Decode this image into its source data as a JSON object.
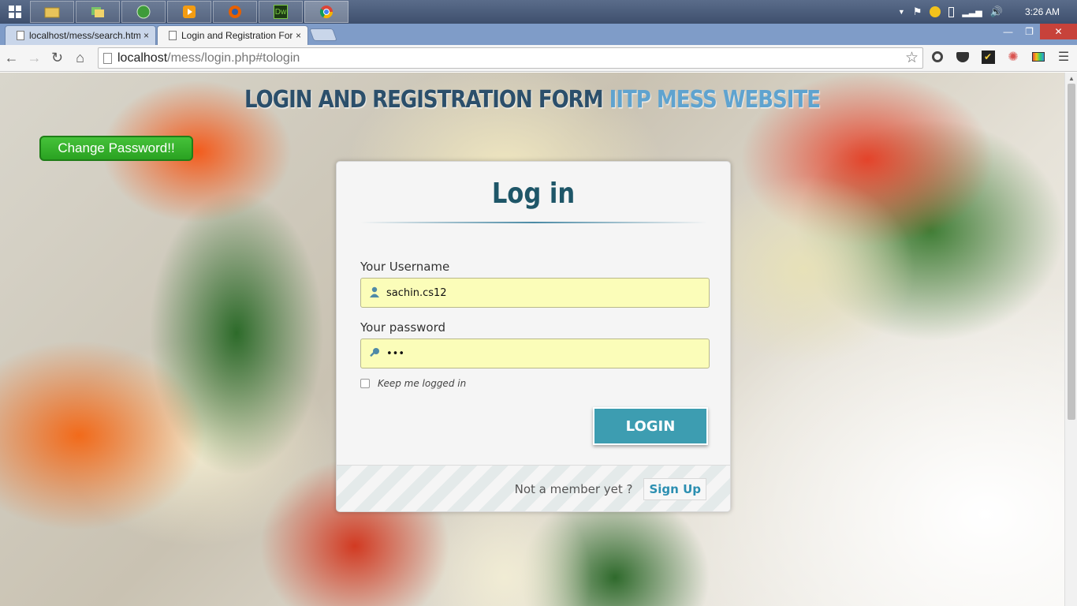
{
  "taskbar": {
    "apps": [
      "File Explorer",
      "Windows Explorer",
      "Network",
      "Media Player",
      "Firefox",
      "Dreamweaver",
      "Chrome"
    ],
    "dw_label": "Dw",
    "clock": "3:26 AM"
  },
  "browser": {
    "tabs": [
      {
        "title": "localhost/mess/search.htm",
        "close": "×"
      },
      {
        "title": "Login and Registration Form",
        "close": "×"
      }
    ],
    "url_host": "localhost",
    "url_path": "/mess/login.php#tologin"
  },
  "page": {
    "heading_part1": "LOGIN AND REGISTRATION FORM",
    "heading_part2": "IITP MESS WEBSITE",
    "change_password_label": "Change Password!!",
    "login": {
      "title": "Log in",
      "username_label": "Your Username",
      "username_value": "sachin.cs12",
      "password_label": "Your password",
      "password_value": "•••",
      "keep_logged_in_label": "Keep me logged in",
      "login_button": "LOGIN",
      "not_member_text": "Not a member yet ?",
      "signup_link": "Sign Up"
    }
  },
  "colors": {
    "heading_dark": "#2b4f6b",
    "heading_light": "#5fa3cf",
    "change_password_bg": "#2aa221",
    "login_button_bg": "#3d9db1",
    "input_bg": "#fbfdb9"
  }
}
